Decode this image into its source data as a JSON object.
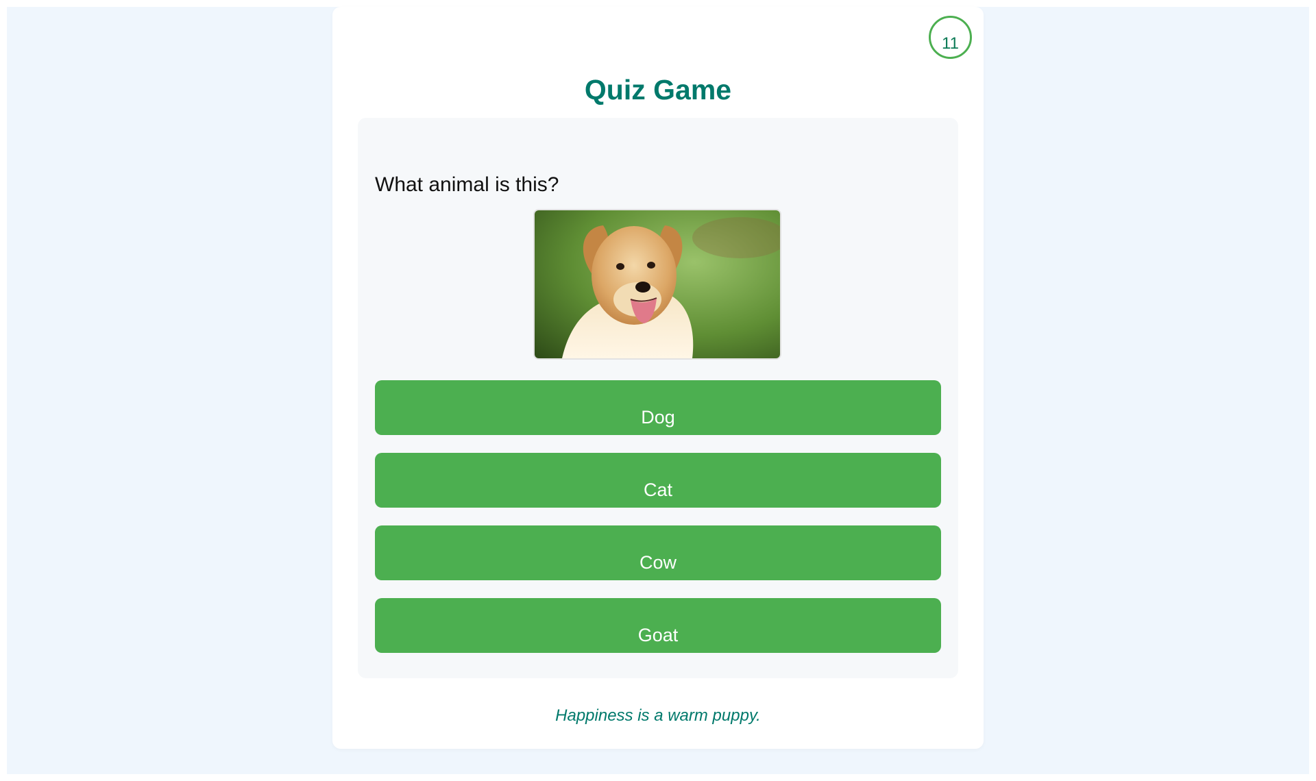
{
  "header": {
    "timer": "11",
    "title": "Quiz Game"
  },
  "question": {
    "text": "What animal is this?",
    "image": "golden-retriever-dog-photo"
  },
  "options": [
    {
      "label": "Dog"
    },
    {
      "label": "Cat"
    },
    {
      "label": "Cow"
    },
    {
      "label": "Goat"
    }
  ],
  "footer": {
    "quote": "Happiness is a warm puppy."
  },
  "colors": {
    "accent": "#4caf50",
    "title": "#00796b",
    "background": "#eff6fd"
  }
}
